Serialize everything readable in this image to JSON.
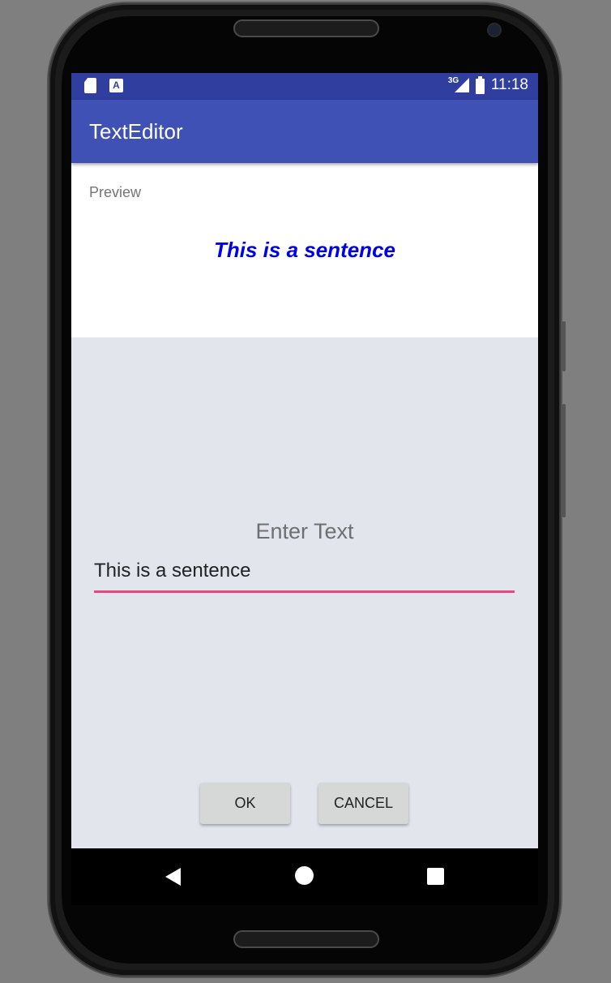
{
  "status_bar": {
    "time": "11:18",
    "network_type": "3G",
    "icons": [
      "sd-card-icon",
      "a-icon",
      "signal-icon",
      "battery-icon"
    ]
  },
  "app_bar": {
    "title": "TextEditor",
    "color": "#3f51b5",
    "status_color": "#303f9f"
  },
  "preview": {
    "label": "Preview",
    "text": "This is a sentence",
    "text_color": "#0000e6"
  },
  "editor": {
    "label": "Enter Text",
    "value": "This is a sentence",
    "underline_color": "#e9467d"
  },
  "buttons": {
    "ok": "OK",
    "cancel": "CANCEL"
  },
  "nav_bar": {
    "icons": [
      "back-icon",
      "home-icon",
      "recents-icon"
    ]
  }
}
